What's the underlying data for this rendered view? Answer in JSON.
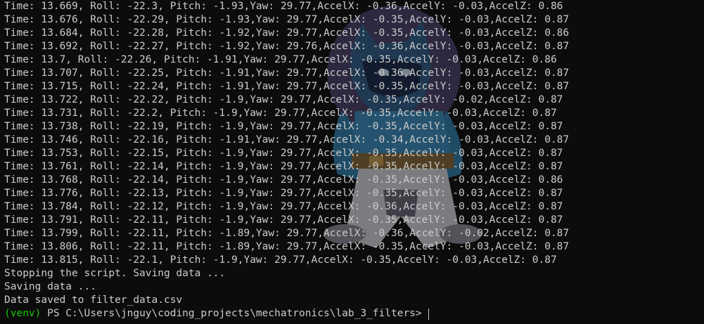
{
  "terminal": {
    "output_lines": [
      "Time: 13.669, Roll: -22.3, Pitch: -1.93,Yaw: 29.77,AccelX: -0.36,AccelY: -0.03,AccelZ: 0.86",
      "Time: 13.676, Roll: -22.29, Pitch: -1.93,Yaw: 29.77,AccelX: -0.35,AccelY: -0.03,AccelZ: 0.87",
      "Time: 13.684, Roll: -22.28, Pitch: -1.92,Yaw: 29.77,AccelX: -0.35,AccelY: -0.03,AccelZ: 0.86",
      "Time: 13.692, Roll: -22.27, Pitch: -1.92,Yaw: 29.76,AccelX: -0.36,AccelY: -0.03,AccelZ: 0.87",
      "Time: 13.7, Roll: -22.26, Pitch: -1.91,Yaw: 29.77,AccelX: -0.35,AccelY: -0.03,AccelZ: 0.86",
      "Time: 13.707, Roll: -22.25, Pitch: -1.91,Yaw: 29.77,AccelX: -0.36,AccelY: -0.03,AccelZ: 0.87",
      "Time: 13.715, Roll: -22.24, Pitch: -1.91,Yaw: 29.77,AccelX: -0.35,AccelY: -0.03,AccelZ: 0.87",
      "Time: 13.722, Roll: -22.22, Pitch: -1.9,Yaw: 29.77,AccelX: -0.35,AccelY: -0.02,AccelZ: 0.87",
      "Time: 13.731, Roll: -22.2, Pitch: -1.9,Yaw: 29.77,AccelX: -0.35,AccelY: -0.03,AccelZ: 0.87",
      "Time: 13.738, Roll: -22.19, Pitch: -1.9,Yaw: 29.77,AccelX: -0.35,AccelY: -0.03,AccelZ: 0.87",
      "Time: 13.746, Roll: -22.16, Pitch: -1.91,Yaw: 29.77,AccelX: -0.34,AccelY: -0.03,AccelZ: 0.87",
      "Time: 13.753, Roll: -22.15, Pitch: -1.9,Yaw: 29.77,AccelX: -0.35,AccelY: -0.03,AccelZ: 0.87",
      "Time: 13.761, Roll: -22.14, Pitch: -1.9,Yaw: 29.77,AccelX: -0.35,AccelY: -0.03,AccelZ: 0.87",
      "Time: 13.768, Roll: -22.14, Pitch: -1.9,Yaw: 29.77,AccelX: -0.35,AccelY: -0.03,AccelZ: 0.86",
      "Time: 13.776, Roll: -22.13, Pitch: -1.9,Yaw: 29.77,AccelX: -0.35,AccelY: -0.03,AccelZ: 0.87",
      "Time: 13.784, Roll: -22.12, Pitch: -1.9,Yaw: 29.77,AccelX: -0.36,AccelY: -0.03,AccelZ: 0.87",
      "Time: 13.791, Roll: -22.11, Pitch: -1.9,Yaw: 29.77,AccelX: -0.35,AccelY: -0.03,AccelZ: 0.87",
      "Time: 13.799, Roll: -22.11, Pitch: -1.89,Yaw: 29.77,AccelX: -0.36,AccelY: -0.02,AccelZ: 0.87",
      "Time: 13.806, Roll: -22.11, Pitch: -1.89,Yaw: 29.77,AccelX: -0.35,AccelY: -0.03,AccelZ: 0.87",
      "Time: 13.815, Roll: -22.1, Pitch: -1.9,Yaw: 29.77,AccelX: -0.35,AccelY: -0.03,AccelZ: 0.87",
      "Stopping the script. Saving data ...",
      "Saving data ...",
      "Data saved to filter_data.csv"
    ],
    "prompt": {
      "venv": "(venv)",
      "path": " PS C:\\Users\\jnguy\\coding_projects\\mechatronics\\lab_3_filters> "
    },
    "background_icon": "cartoon-character-background-icon",
    "colors": {
      "background": "#0c0c0c",
      "text": "#cccccc",
      "venv": "#16c60c"
    }
  }
}
